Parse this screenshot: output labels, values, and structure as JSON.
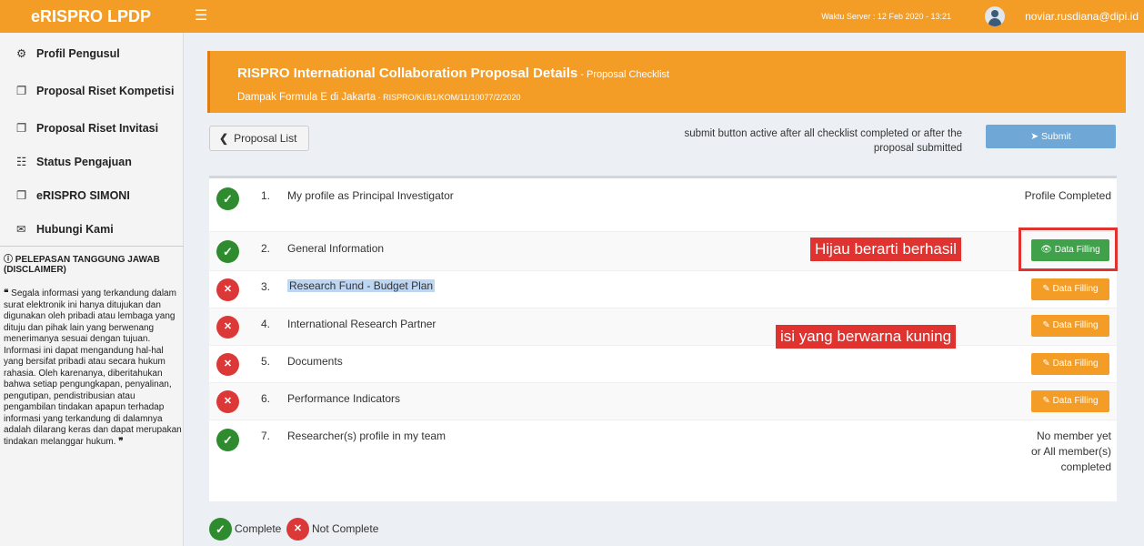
{
  "app": {
    "brand": "eRISPRO LPDP",
    "menu_icon": "☰",
    "server_time": "Waktu Server : 12 Feb 2020 - 13:21",
    "user_email": "noviar.rusdiana@dipi.id"
  },
  "sidebar": {
    "items": [
      {
        "icon": "⚙",
        "icon_name": "dashboard-icon",
        "label": "Profil Pengusul"
      },
      {
        "icon": "❐",
        "icon_name": "copy-icon",
        "label": "Proposal Riset Kompetisi"
      },
      {
        "icon": "❐",
        "icon_name": "copy-icon",
        "label": "Proposal Riset Invitasi"
      },
      {
        "icon": "☷",
        "icon_name": "grid-icon",
        "label": "Status Pengajuan"
      },
      {
        "icon": "❐",
        "icon_name": "copy-icon",
        "label": "eRISPRO SIMONI"
      },
      {
        "icon": "✉",
        "icon_name": "envelope-icon",
        "label": "Hubungi Kami"
      }
    ],
    "disclaimer_title": "PELEPASAN TANGGUNG JAWAB (DISCLAIMER)",
    "disclaimer_text": "Segala informasi yang terkandung dalam surat elektronik ini hanya ditujukan dan digunakan oleh pribadi atau lembaga yang dituju dan pihak lain yang berwenang menerimanya sesuai dengan tujuan. Informasi ini dapat mengandung hal-hal yang bersifat pribadi atau secara hukum rahasia. Oleh karenanya, diberitahukan bahwa setiap pengungkapan, penyalinan, pengutipan, pendistribusian atau pengambilan tindakan apapun terhadap informasi yang terkandung di dalamnya adalah dilarang keras dan dapat merupakan tindakan melanggar hukum."
  },
  "header": {
    "title": "RISPRO International Collaboration Proposal Details",
    "title_suffix": " - Proposal Checklist",
    "subtitle": "Dampak Formula E di Jakarta",
    "subtitle_suffix": " - RISPRO/KI/B1/KOM/11/10077/2/2020"
  },
  "toolbar": {
    "back_label": "Proposal List",
    "submit_note": "submit button active after all checklist completed or after the proposal submitted",
    "submit_label": "Submit"
  },
  "checklist": [
    {
      "num": "1.",
      "label": "My profile as Principal Investigator",
      "complete": true,
      "status_text": "Profile Completed"
    },
    {
      "num": "2.",
      "label": "General Information",
      "complete": true,
      "button": "Data Filling"
    },
    {
      "num": "3.",
      "label": "Research Fund - Budget Plan",
      "complete": false,
      "button": "Data Filling"
    },
    {
      "num": "4.",
      "label": "International Research Partner",
      "complete": false,
      "button": "Data Filling"
    },
    {
      "num": "5.",
      "label": "Documents",
      "complete": false,
      "button": "Data Filling"
    },
    {
      "num": "6.",
      "label": "Performance Indicators",
      "complete": false,
      "button": "Data Filling"
    },
    {
      "num": "7.",
      "label": "Researcher(s) profile in my team",
      "complete": true,
      "status_text": "No member yet or All member(s) completed"
    }
  ],
  "annotations": {
    "green": "Hijau berarti berhasil",
    "yellow": "isi yang berwarna kuning"
  },
  "legend": {
    "complete": "Complete",
    "not_complete": "Not Complete"
  },
  "colors": {
    "brand_orange": "#f39c26",
    "success_green": "#2e8b2e",
    "error_red": "#dd3838",
    "submit_blue": "#6fa8d6",
    "annotation_red": "#e0322f"
  }
}
